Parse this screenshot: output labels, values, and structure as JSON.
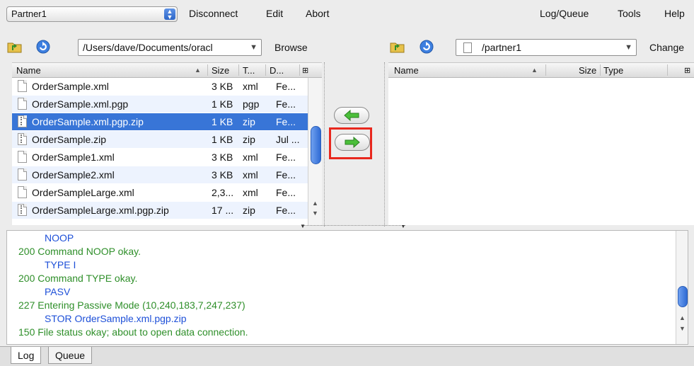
{
  "menubar": {
    "partner_value": "Partner1",
    "disconnect": "Disconnect",
    "edit": "Edit",
    "abort": "Abort",
    "log_queue": "Log/Queue",
    "tools": "Tools",
    "help": "Help"
  },
  "local": {
    "path": "/Users/dave/Documents/oracl",
    "browse": "Browse",
    "columns": [
      "Name",
      "Size",
      "T...",
      "D..."
    ],
    "files": [
      {
        "name": "OrderSample.xml",
        "size": "3 KB",
        "type": "xml",
        "date": "Fe..."
      },
      {
        "name": "OrderSample.xml.pgp",
        "size": "1 KB",
        "type": "pgp",
        "date": "Fe..."
      },
      {
        "name": "OrderSample.xml.pgp.zip",
        "size": "1 KB",
        "type": "zip",
        "date": "Fe..."
      },
      {
        "name": "OrderSample.zip",
        "size": "1 KB",
        "type": "zip",
        "date": "Jul ..."
      },
      {
        "name": "OrderSample1.xml",
        "size": "3 KB",
        "type": "xml",
        "date": "Fe..."
      },
      {
        "name": "OrderSample2.xml",
        "size": "3 KB",
        "type": "xml",
        "date": "Fe..."
      },
      {
        "name": "OrderSampleLarge.xml",
        "size": "2,3...",
        "type": "xml",
        "date": "Fe..."
      },
      {
        "name": "OrderSampleLarge.xml.pgp.zip",
        "size": "17 ...",
        "type": "zip",
        "date": "Fe..."
      }
    ],
    "selected_index": 2
  },
  "remote": {
    "path": "/partner1",
    "change": "Change",
    "columns": [
      "Name",
      "Size",
      "Type"
    ]
  },
  "log": {
    "lines": [
      {
        "kind": "cmd",
        "text": "NOOP"
      },
      {
        "kind": "resp",
        "text": "200 Command NOOP okay."
      },
      {
        "kind": "cmd",
        "text": "TYPE I"
      },
      {
        "kind": "resp",
        "text": "200 Command TYPE okay."
      },
      {
        "kind": "cmd",
        "text": "PASV"
      },
      {
        "kind": "resp",
        "text": "227 Entering Passive Mode (10,240,183,7,247,237)"
      },
      {
        "kind": "cmd",
        "text": "STOR OrderSample.xml.pgp.zip"
      },
      {
        "kind": "resp",
        "text": "150 File status okay; about to open data connection."
      }
    ]
  },
  "tabs": {
    "log": "Log",
    "queue": "Queue"
  },
  "colors": {
    "selection": "#3875d7",
    "command": "#1e50d8",
    "response": "#2f8f2a",
    "highlight": "#e8281e"
  }
}
